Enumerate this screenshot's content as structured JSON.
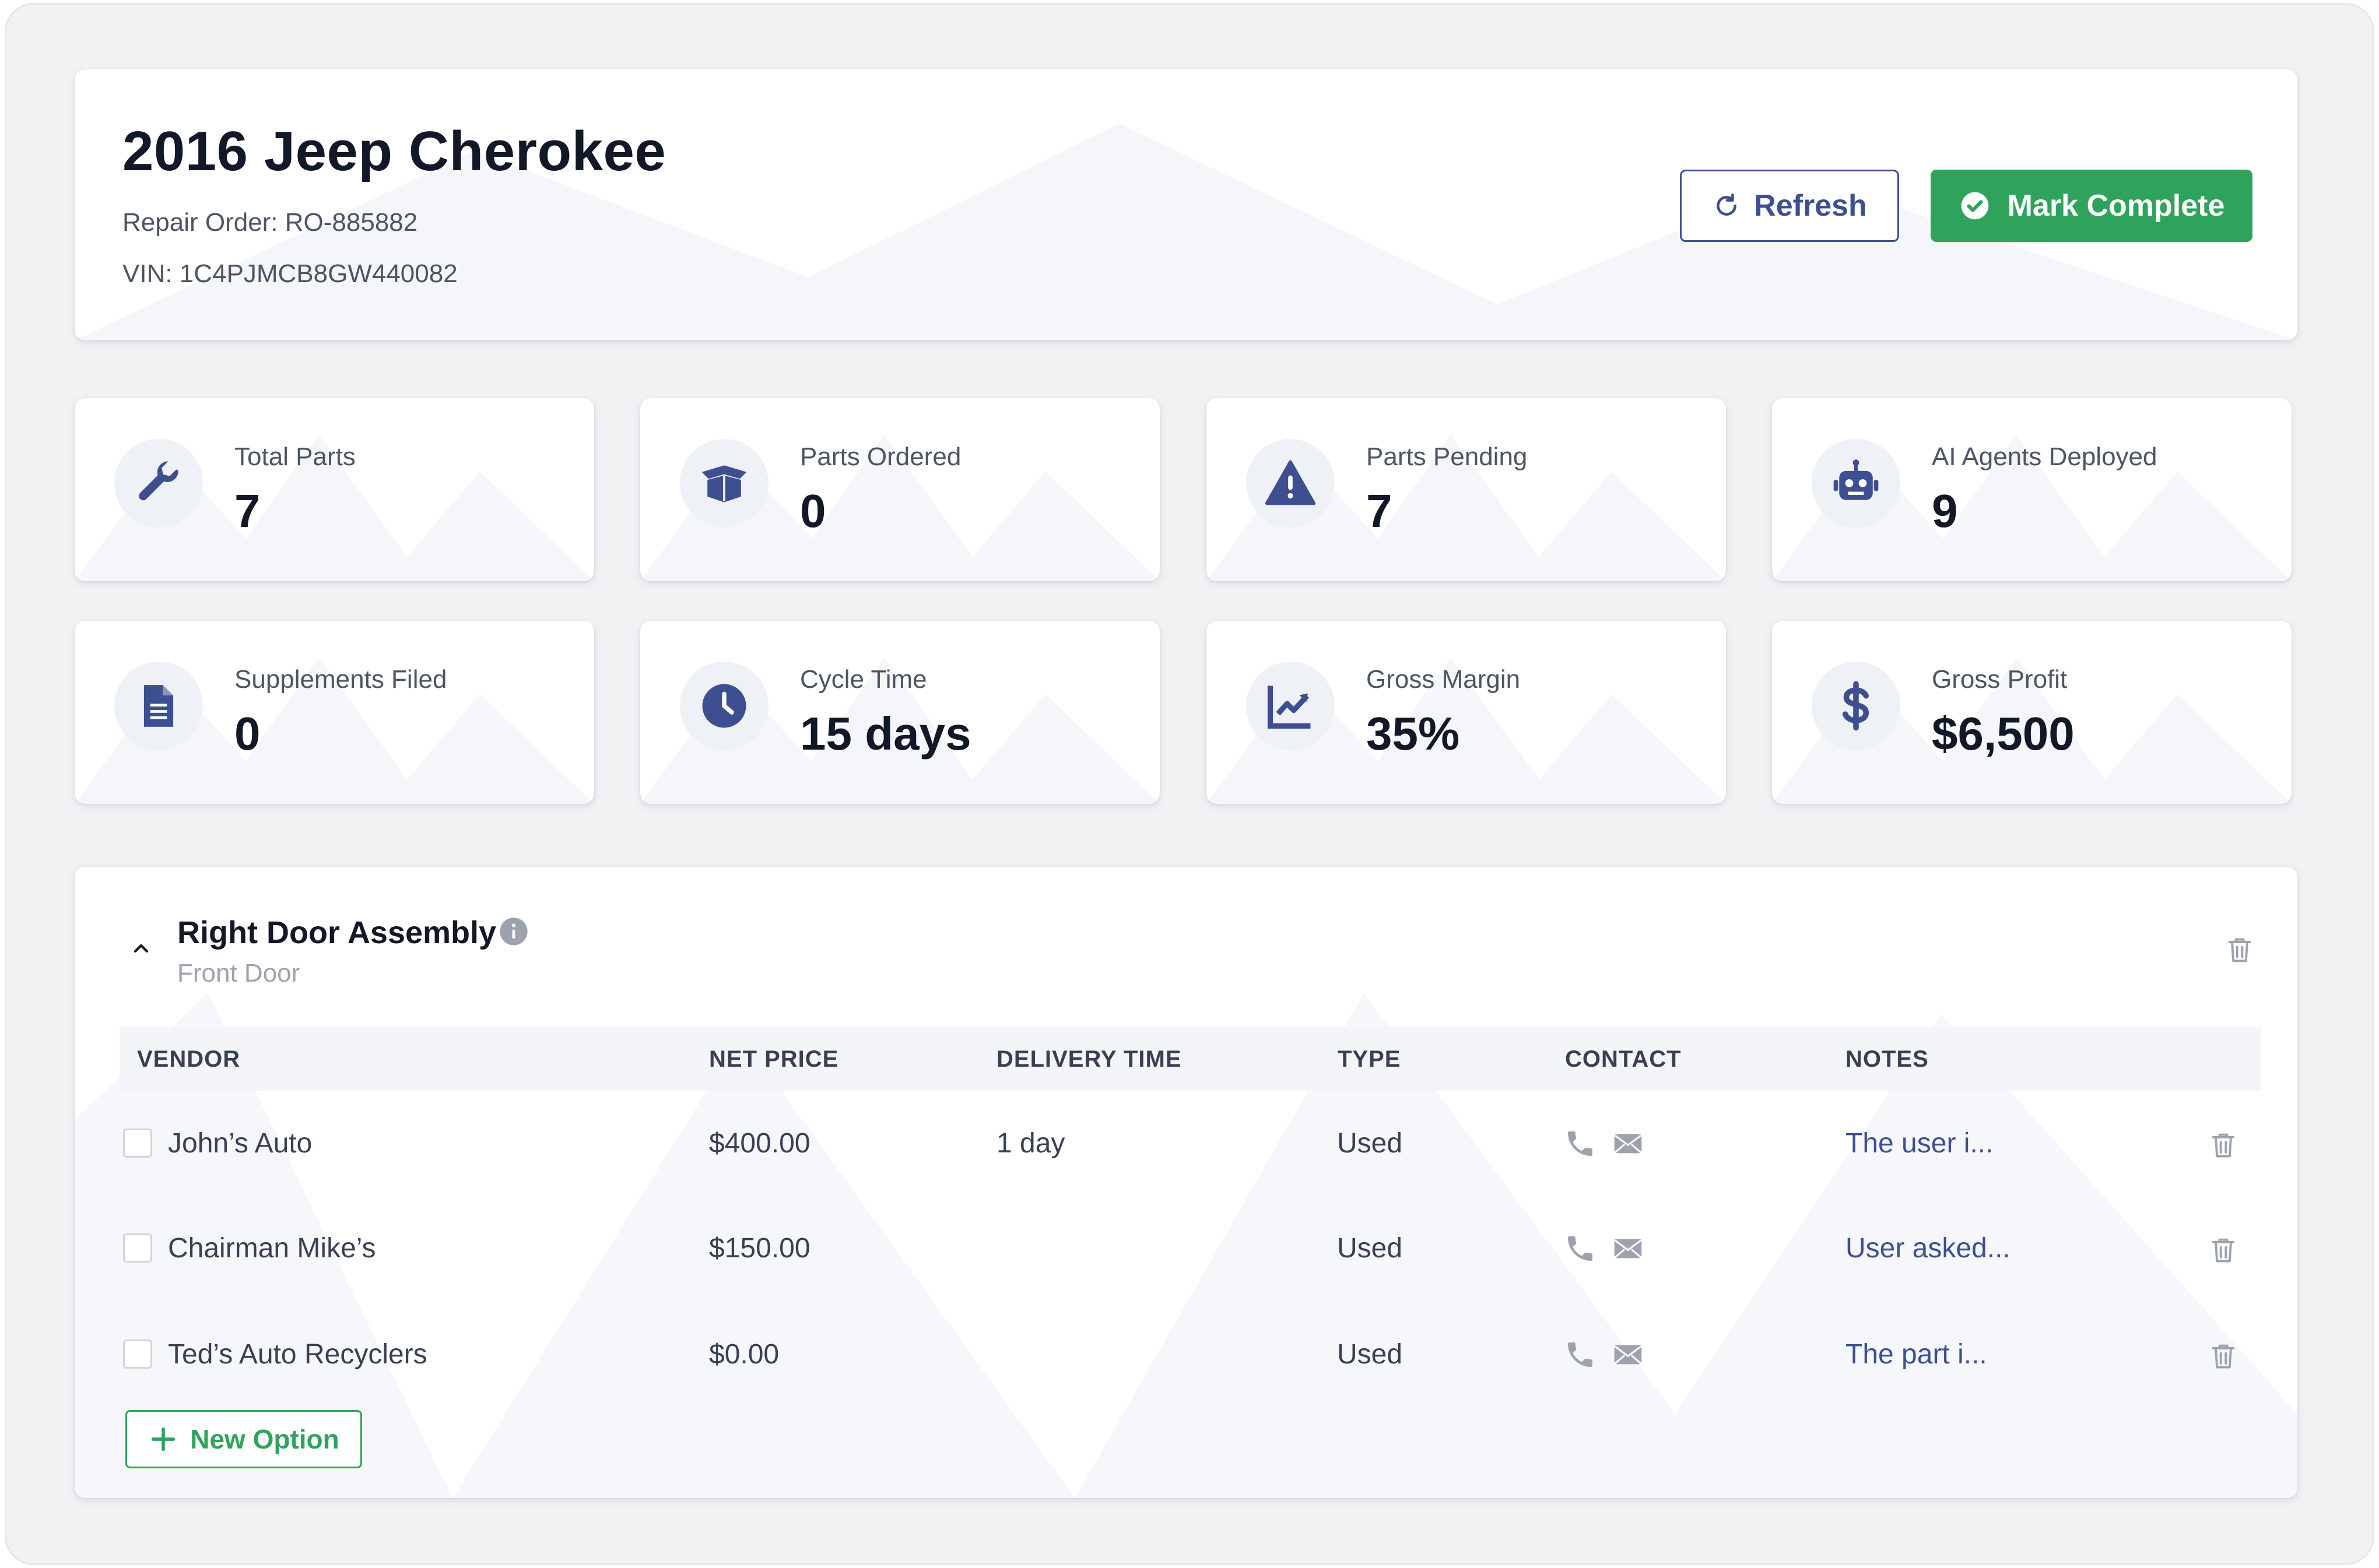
{
  "header": {
    "vehicle_title": "2016 Jeep Cherokee",
    "repair_order": "Repair Order: RO-885882",
    "vin": "VIN: 1C4PJMCB8GW440082",
    "refresh_label": "Refresh",
    "complete_label": "Mark Complete"
  },
  "stats": [
    {
      "label": "Total Parts",
      "value": "7",
      "icon": "wrench-icon"
    },
    {
      "label": "Parts Ordered",
      "value": "0",
      "icon": "box-open-icon"
    },
    {
      "label": "Parts Pending",
      "value": "7",
      "icon": "warning-icon"
    },
    {
      "label": "AI Agents Deployed",
      "value": "9",
      "icon": "robot-icon"
    },
    {
      "label": "Supplements Filed",
      "value": "0",
      "icon": "document-icon"
    },
    {
      "label": "Cycle Time",
      "value": "15 days",
      "icon": "clock-icon"
    },
    {
      "label": "Gross Margin",
      "value": "35%",
      "icon": "chart-line-icon"
    },
    {
      "label": "Gross Profit",
      "value": "$6,500",
      "icon": "dollar-icon"
    }
  ],
  "part": {
    "name": "Right Door Assembly",
    "subtitle": "Front Door",
    "columns": [
      "VENDOR",
      "NET PRICE",
      "DELIVERY TIME",
      "TYPE",
      "CONTACT",
      "NOTES"
    ],
    "rows": [
      {
        "vendor": "John’s Auto",
        "price": "$400.00",
        "delivery": "1 day",
        "type": "Used",
        "notes": "The user i..."
      },
      {
        "vendor": "Chairman Mike’s",
        "price": "$150.00",
        "delivery": "",
        "type": "Used",
        "notes": "User asked..."
      },
      {
        "vendor": "Ted’s Auto Recyclers",
        "price": "$0.00",
        "delivery": "",
        "type": "Used",
        "notes": "The part i..."
      }
    ],
    "new_option_label": "New Option"
  },
  "colors": {
    "accent_blue": "#3d4f91",
    "accent_green": "#2fa35c",
    "background": "#f1f2f4"
  }
}
